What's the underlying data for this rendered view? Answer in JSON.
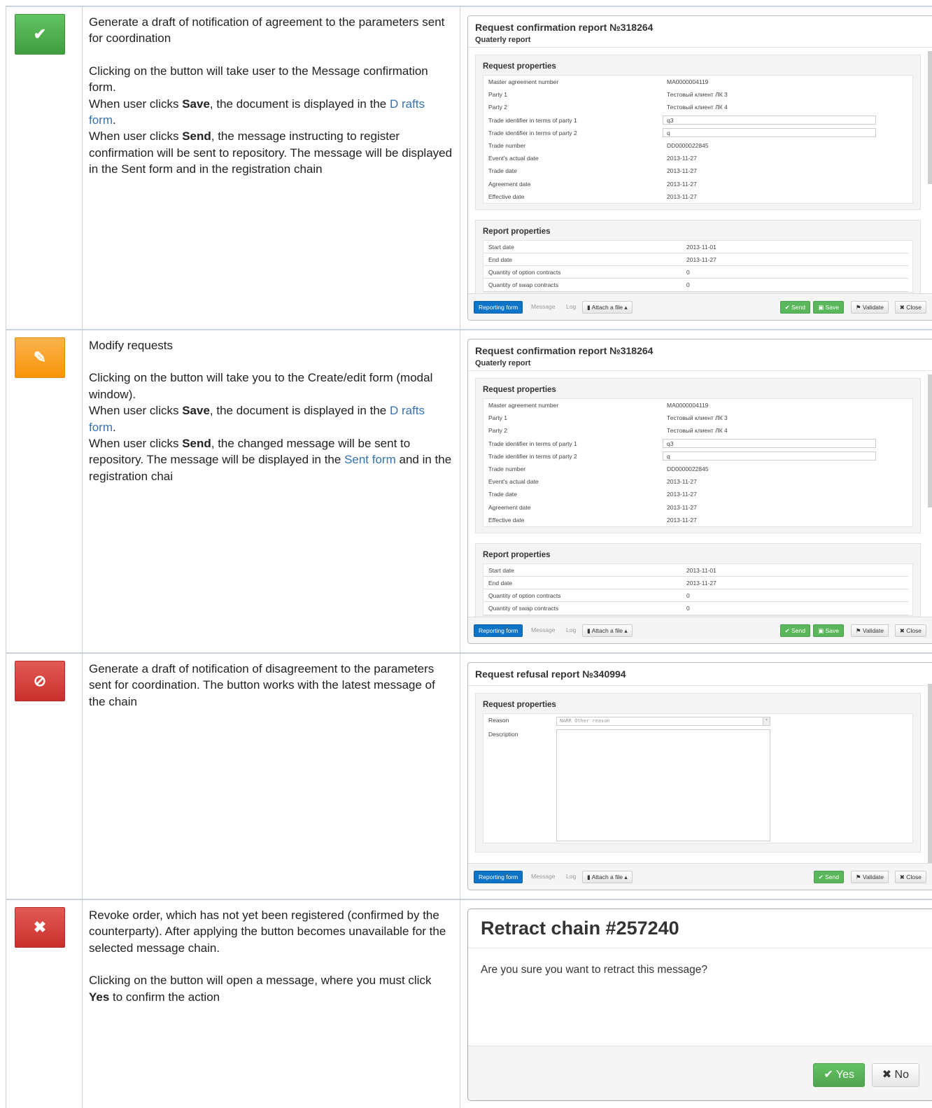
{
  "rows": [
    {
      "desc": [
        "Generate a draft of notification of agreement to the parameters sent for coordination",
        "Clicking on the button will take user to the Message confirmation form.",
        "When user clicks ",
        "Save",
        ", the document is displayed in the ",
        "D rafts form",
        ".",
        "When user clicks ",
        "Send",
        ", the message instructing to register confirmation will be sent to repository. The message will be displayed in the Sent form and in the registration chain"
      ]
    },
    {
      "desc": [
        "Modify requests",
        "Clicking on the button will take you to the Create/edit form (modal window).",
        "When user clicks ",
        "Save",
        ", the document is displayed in the ",
        "D rafts form",
        ".",
        "When user clicks ",
        "Send",
        ", the changed message will be sent to repository. The message will be displayed in the ",
        "Sent form",
        " and in the registration chai"
      ]
    },
    {
      "desc": [
        "Generate a draft of notification of disagreement to the parameters sent for coordination. The button works with the latest message of the chain"
      ]
    },
    {
      "desc": [
        "Revoke order, which has not yet been registered (confirmed  by the counterparty). After applying the button becomes unavailable for the selected message chain.",
        "Clicking on the button will open a message, where you must click ",
        "Yes",
        " to confirm the action"
      ]
    }
  ],
  "confirm_report": {
    "title": "Request confirmation report №318264",
    "subtitle": "Quaterly report",
    "req_heading": "Request properties",
    "req_rows": [
      [
        "Master agreement number",
        "MA0000004119"
      ],
      [
        "Party 1",
        "Тестовый клиент ЛК 3"
      ],
      [
        "Party 2",
        "Тестовый клиент ЛК 4"
      ],
      [
        "Trade identifier in terms of party 1",
        "q3"
      ],
      [
        "Trade identifier in terms of party 2",
        "q"
      ],
      [
        "Trade number",
        "DD0000022845"
      ],
      [
        "Event's actual date",
        "2013-11-27"
      ],
      [
        "Trade date",
        "2013-11-27"
      ],
      [
        "Agreement date",
        "2013-11-27"
      ],
      [
        "Effective date",
        "2013-11-27"
      ]
    ],
    "rep_heading": "Report properties",
    "rep_rows": [
      [
        "Start date",
        "2013-11-01"
      ],
      [
        "End date",
        "2013-11-27"
      ],
      [
        "Quantity of option contracts",
        "0"
      ],
      [
        "Quantity of swap contracts",
        "0"
      ]
    ]
  },
  "refusal_report": {
    "title": "Request refusal report №340994",
    "req_heading": "Request properties",
    "reason_label": "Reason",
    "reason_value": "NARR Other reason",
    "description_label": "Description"
  },
  "footer": {
    "reporting_form": "Reporting form",
    "message": "Message",
    "log": "Log",
    "attach": "Attach a file",
    "send": "Send",
    "save": "Save",
    "validate": "Validate",
    "close": "Close"
  },
  "retract": {
    "title": "Retract chain #257240",
    "body": "Are you sure you want to retract this message?",
    "yes": "Yes",
    "no": "No"
  },
  "colors": {
    "green": "#5bb75b",
    "orange": "#f89406",
    "red": "#c9302c",
    "blue": "#0e74c8",
    "link": "#3572b0"
  }
}
